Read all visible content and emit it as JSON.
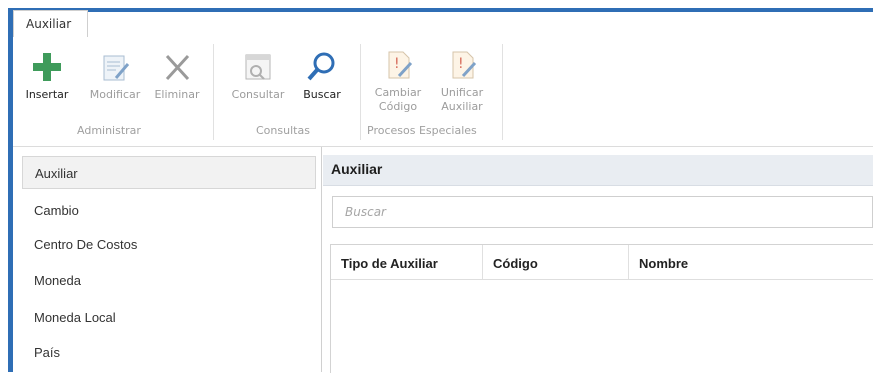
{
  "tab": {
    "label": "Auxiliar"
  },
  "ribbon": {
    "buttons": [
      {
        "label": "Insertar",
        "icon": "plus-icon",
        "enabled": true
      },
      {
        "label": "Modificar",
        "icon": "edit-document-icon",
        "enabled": false
      },
      {
        "label": "Eliminar",
        "icon": "delete-x-icon",
        "enabled": false
      },
      {
        "label": "Consultar",
        "icon": "window-search-icon",
        "enabled": false
      },
      {
        "label": "Buscar",
        "icon": "search-icon",
        "enabled": true
      },
      {
        "label": "Cambiar\nCódigo",
        "icon": "change-code-icon",
        "enabled": false
      },
      {
        "label": "Unificar\nAuxiliar",
        "icon": "unify-icon",
        "enabled": false
      }
    ],
    "groups": [
      {
        "label": "Administrar"
      },
      {
        "label": "Consultas"
      },
      {
        "label": "Procesos Especiales"
      }
    ],
    "colors": {
      "insert_green": "#3f9b5b",
      "search_blue": "#2f6eb5",
      "accent_border": "#2f6eb5"
    }
  },
  "sidebar": {
    "items": [
      {
        "label": "Auxiliar",
        "selected": true
      },
      {
        "label": "Cambio"
      },
      {
        "label": "Centro De Costos"
      },
      {
        "label": "Moneda"
      },
      {
        "label": "Moneda Local"
      },
      {
        "label": "País"
      }
    ]
  },
  "panel": {
    "title": "Auxiliar",
    "search_placeholder": "Buscar",
    "columns": [
      "Tipo de Auxiliar",
      "Código",
      "Nombre"
    ],
    "rows": []
  }
}
